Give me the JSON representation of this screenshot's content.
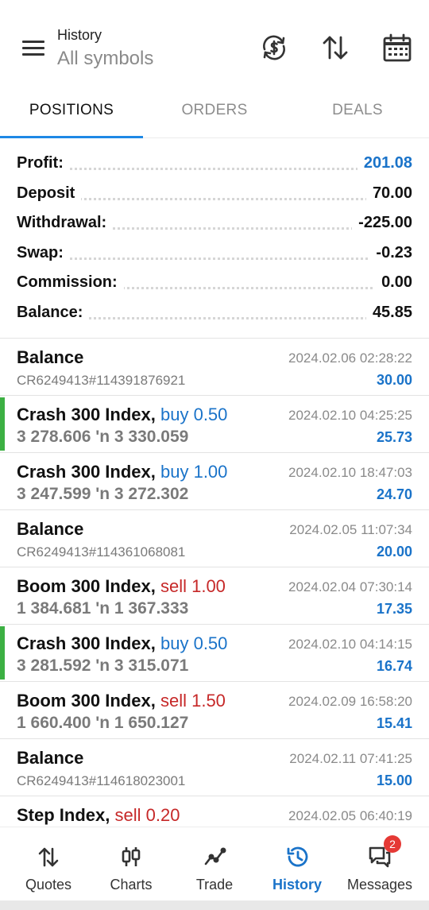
{
  "header": {
    "title": "History",
    "subtitle": "All symbols"
  },
  "tabs": [
    {
      "label": "POSITIONS",
      "active": true
    },
    {
      "label": "ORDERS",
      "active": false
    },
    {
      "label": "DEALS",
      "active": false
    }
  ],
  "summary": [
    {
      "label": "Profit:",
      "value": "201.08",
      "highlight": true
    },
    {
      "label": "Deposit",
      "value": "70.00",
      "highlight": false
    },
    {
      "label": "Withdrawal:",
      "value": "-225.00",
      "highlight": false
    },
    {
      "label": "Swap:",
      "value": "-0.23",
      "highlight": false
    },
    {
      "label": "Commission:",
      "value": "0.00",
      "highlight": false
    },
    {
      "label": "Balance:",
      "value": "45.85",
      "highlight": false
    }
  ],
  "items": [
    {
      "type": "balance",
      "name": "Balance",
      "id": "CR6249413#114391876921",
      "time": "2024.02.06 02:28:22",
      "profit": "30.00"
    },
    {
      "type": "trade",
      "symbol": "Crash 300 Index,",
      "action": "buy",
      "volume": "buy 0.50",
      "prices": "3 278.606 'n  3 330.059",
      "time": "2024.02.10 04:25:25",
      "profit": "25.73",
      "marked": true
    },
    {
      "type": "trade",
      "symbol": "Crash 300 Index,",
      "action": "buy",
      "volume": "buy 1.00",
      "prices": "3 247.599 'n  3 272.302",
      "time": "2024.02.10 18:47:03",
      "profit": "24.70",
      "marked": false
    },
    {
      "type": "balance",
      "name": "Balance",
      "id": "CR6249413#114361068081",
      "time": "2024.02.05 11:07:34",
      "profit": "20.00"
    },
    {
      "type": "trade",
      "symbol": "Boom 300 Index,",
      "action": "sell",
      "volume": "sell 1.00",
      "prices": "1 384.681 'n  1 367.333",
      "time": "2024.02.04 07:30:14",
      "profit": "17.35",
      "marked": false
    },
    {
      "type": "trade",
      "symbol": "Crash 300 Index,",
      "action": "buy",
      "volume": "buy 0.50",
      "prices": "3 281.592 'n  3 315.071",
      "time": "2024.02.10 04:14:15",
      "profit": "16.74",
      "marked": true
    },
    {
      "type": "trade",
      "symbol": "Boom 300 Index,",
      "action": "sell",
      "volume": "sell 1.50",
      "prices": "1 660.400 'n  1 650.127",
      "time": "2024.02.09 16:58:20",
      "profit": "15.41",
      "marked": false
    },
    {
      "type": "balance",
      "name": "Balance",
      "id": "CR6249413#114618023001",
      "time": "2024.02.11 07:41:25",
      "profit": "15.00"
    },
    {
      "type": "trade",
      "symbol": "Step Index,",
      "action": "sell",
      "volume": "sell 0.20",
      "prices": "",
      "time": "2024.02.05 06:40:19",
      "profit": "",
      "marked": false
    }
  ],
  "nav": [
    {
      "label": "Quotes",
      "icon": "quotes-icon",
      "active": false
    },
    {
      "label": "Charts",
      "icon": "charts-icon",
      "active": false
    },
    {
      "label": "Trade",
      "icon": "trade-icon",
      "active": false
    },
    {
      "label": "History",
      "icon": "history-icon",
      "active": true
    },
    {
      "label": "Messages",
      "icon": "messages-icon",
      "active": false,
      "badge": "2"
    }
  ],
  "colors": {
    "accent": "#1e88e5",
    "buy": "#1a73c9",
    "sell": "#c62828",
    "marker": "#3cb043",
    "badge": "#e53935"
  }
}
